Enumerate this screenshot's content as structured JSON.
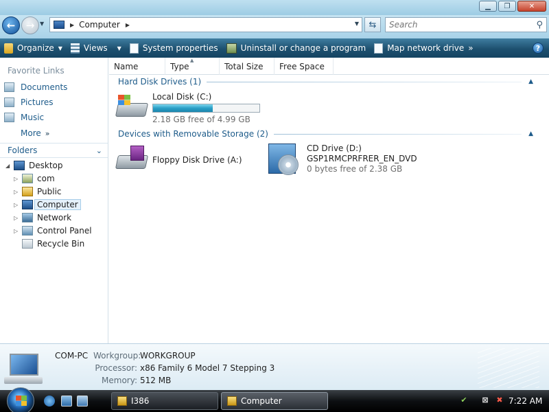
{
  "window": {
    "minimize_icon": "minimize-icon",
    "maximize_icon": "maximize-icon",
    "close_icon": "close-icon"
  },
  "address": {
    "location": "Computer",
    "search_placeholder": "Search"
  },
  "toolbar": {
    "organize": "Organize",
    "views": "Views",
    "system_properties": "System properties",
    "uninstall": "Uninstall or change a program",
    "map_drive": "Map network drive",
    "more": "»",
    "help": "?"
  },
  "nav": {
    "favorite_links_title": "Favorite Links",
    "favorites": [
      "Documents",
      "Pictures",
      "Music"
    ],
    "more": "More",
    "folders_title": "Folders",
    "tree": [
      "Desktop",
      "com",
      "Public",
      "Computer",
      "Network",
      "Control Panel",
      "Recycle Bin"
    ]
  },
  "columns": [
    "Name",
    "Type",
    "Total Size",
    "Free Space"
  ],
  "groups": {
    "hdd": "Hard Disk Drives (1)",
    "removable": "Devices with Removable Storage (2)"
  },
  "drives": {
    "local": {
      "name": "Local Disk (C:)",
      "free_text": "2.18 GB free of 4.99 GB",
      "used_fraction": 0.56
    },
    "floppy": {
      "name": "Floppy Disk Drive (A:)"
    },
    "cd": {
      "name": "CD Drive (D:)",
      "label": "GSP1RMCPRFRER_EN_DVD",
      "free_text": "0 bytes free of 2.38 GB"
    }
  },
  "details": {
    "computer_name": "COM-PC",
    "workgroup_label": "Workgroup:",
    "workgroup_value": "WORKGROUP",
    "processor_label": "Processor:",
    "processor_value": "x86 Family 6 Model 7 Stepping 3",
    "memory_label": "Memory:",
    "memory_value": "512 MB"
  },
  "taskbar": {
    "tasks": [
      "I386",
      "Computer"
    ],
    "clock": "7:22 AM"
  },
  "colors": {
    "toolbar": "#1d506f",
    "link": "#1d5b8a",
    "progress": "#2a9fc7"
  }
}
